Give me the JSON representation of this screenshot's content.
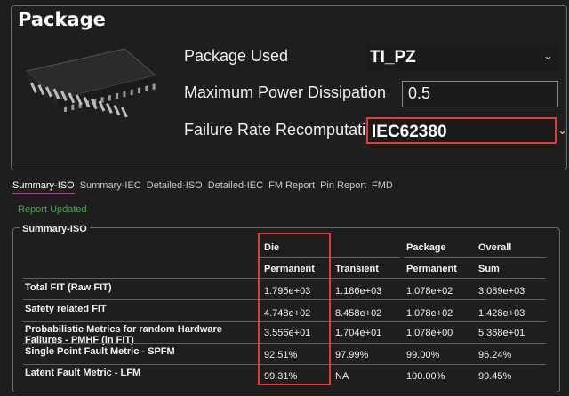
{
  "package": {
    "title": "Package",
    "chip_icon": "ic-chip-icon",
    "package_used_label": "Package Used",
    "package_used_value": "TI_PZ",
    "max_power_label": "Maximum Power Dissipation",
    "max_power_value": "0.5",
    "failure_rate_label": "Failure Rate Recomputation",
    "failure_rate_value": "IEC62380"
  },
  "tabs": [
    "Summary-ISO",
    "Summary-IEC",
    "Detailed-ISO",
    "Detailed-IEC",
    "FM Report",
    "Pin Report",
    "FMD"
  ],
  "status": "Report Updated",
  "summary": {
    "title": "Summary-ISO",
    "group_headers": [
      "Die",
      "Package",
      "Overall"
    ],
    "sub_headers": [
      "Permanent",
      "Transient",
      "Permanent",
      "Sum"
    ],
    "rows": [
      {
        "label": "Total FIT (Raw FIT)",
        "values": [
          "1.795e+03",
          "1.186e+03",
          "1.078e+02",
          "3.089e+03"
        ]
      },
      {
        "label": "Safety related FIT",
        "values": [
          "4.748e+02",
          "8.458e+02",
          "1.078e+02",
          "1.428e+03"
        ]
      },
      {
        "label": "Probabilistic Metrics for random Hardware Failures - PMHF (in FIT)",
        "values": [
          "3.556e+01",
          "1.704e+01",
          "1.078e+00",
          "5.368e+01"
        ]
      },
      {
        "label": "Single Point Fault Metric - SPFM",
        "values": [
          "92.51%",
          "97.99%",
          "99.00%",
          "96.24%"
        ]
      },
      {
        "label": "Latent Fault Metric - LFM",
        "values": [
          "99.31%",
          "NA",
          "100.00%",
          "99.45%"
        ]
      }
    ]
  },
  "colors": {
    "background": "#1e1e1e",
    "highlight": "#e23b3b",
    "active_tab": "#b03a8c",
    "status_green": "#3fa843"
  }
}
